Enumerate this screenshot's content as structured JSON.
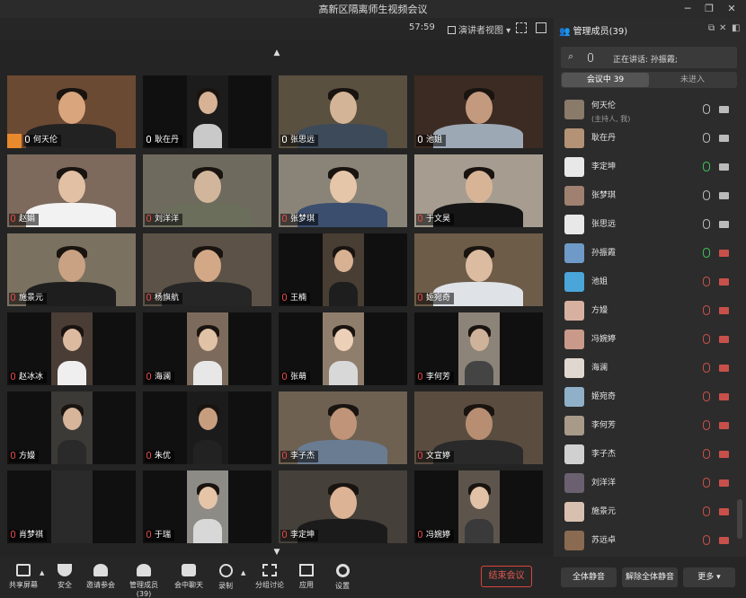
{
  "window": {
    "title": "高新区隔离师生视频会议"
  },
  "subbar": {
    "timer": "57:59",
    "view_mode": "演讲者视图"
  },
  "tiles": [
    {
      "name": "何天伦",
      "host": true,
      "bg": "#6b4a33",
      "fg": "#d9a57c",
      "shirt": "#222"
    },
    {
      "name": "耿在丹",
      "bg": "#1c1c1c",
      "fg": "#d7b295",
      "shirt": "#c9c9c9"
    },
    {
      "name": "张思远",
      "bg": "#5a5040",
      "fg": "#d4b497",
      "shirt": "#3d4a5a"
    },
    {
      "name": "池姐",
      "bg": "#3c2b22",
      "fg": "#c49a7e",
      "shirt": "#9da8b5"
    },
    {
      "name": "赵娟",
      "bg": "#7d6a5c",
      "fg": "#e1c0a4",
      "shirt": "#f2f2f2"
    },
    {
      "name": "刘洋洋",
      "bg": "#6e6a5e",
      "fg": "#d2b69c",
      "shirt": "#6b6e5a"
    },
    {
      "name": "张梦琪",
      "bg": "#8a8478",
      "fg": "#e6c6a8",
      "shirt": "#3b4e6e"
    },
    {
      "name": "于文昊",
      "bg": "#a69d90",
      "fg": "#d8b497",
      "shirt": "#151515"
    },
    {
      "name": "施景元",
      "bg": "#7b7160",
      "fg": "#c9a283",
      "shirt": "#1e1e1e"
    },
    {
      "name": "杨旗航",
      "bg": "#5c5247",
      "fg": "#d3a887",
      "shirt": "#262626"
    },
    {
      "name": "王楠",
      "bg": "#493e33",
      "fg": "#d8b193",
      "shirt": "#1e1e1e"
    },
    {
      "name": "姬宛奇",
      "bg": "#6d5c48",
      "fg": "#dcbca0",
      "shirt": "#dfe3e8"
    },
    {
      "name": "赵冰冰",
      "bg": "#4a3d36",
      "fg": "#dcbaa0",
      "shirt": "#efefef"
    },
    {
      "name": "海澜",
      "bg": "#7c6b5c",
      "fg": "#e0c2a6",
      "shirt": "#e7e7e7"
    },
    {
      "name": "张萌",
      "bg": "#907e6c",
      "fg": "#ecd0b8",
      "shirt": "#d8d8d8"
    },
    {
      "name": "李何芳",
      "bg": "#8c8478",
      "fg": "#cfb29a",
      "shirt": "#444"
    },
    {
      "name": "方嫚",
      "bg": "#3b3a36",
      "fg": "#d6b59a",
      "shirt": "#2a2a2a"
    },
    {
      "name": "朱优",
      "bg": "#1b1b1b",
      "fg": "#c79d80",
      "shirt": "#222"
    },
    {
      "name": "李子杰",
      "bg": "#6e6152",
      "fg": "#bf9478",
      "shirt": "#6a7c92"
    },
    {
      "name": "文宣婷",
      "bg": "#5a4d40",
      "fg": "#b78e72",
      "shirt": "#2a2a2a"
    },
    {
      "name": "肖梦祺",
      "bg": "#2a2a2a",
      "fg": "#2a2a2a",
      "shirt": "#2a2a2a"
    },
    {
      "name": "于瑞",
      "bg": "#8d8b86",
      "fg": "#e5c4a8",
      "shirt": "#d8d8d8"
    },
    {
      "name": "李定坤",
      "bg": "#45403a",
      "fg": "#dcb394",
      "shirt": "#1b1b1b"
    },
    {
      "name": "冯婉婷",
      "bg": "#5d554c",
      "fg": "#e1c2a6",
      "shirt": "#3a3a3a"
    }
  ],
  "panel": {
    "title": "管理成员(39)",
    "speaking": "正在讲话: 孙振霞;",
    "tab_in": "会议中 39",
    "tab_out": "未进入",
    "members": [
      {
        "name": "何天伦",
        "sub": "(主持人, 我)",
        "mic": "normal",
        "cam": "on",
        "av": "#8a7a6a"
      },
      {
        "name": "耿在丹",
        "mic": "normal",
        "cam": "on",
        "av": "#b49276"
      },
      {
        "name": "李定坤",
        "mic": "on",
        "cam": "on",
        "av": "#e8e8e8"
      },
      {
        "name": "张梦琪",
        "mic": "normal",
        "cam": "on",
        "av": "#a08070"
      },
      {
        "name": "张思远",
        "mic": "normal",
        "cam": "on",
        "av": "#e8e8e8"
      },
      {
        "name": "孙振霞",
        "mic": "on",
        "cam": "off",
        "av": "#6f9ac8"
      },
      {
        "name": "池姐",
        "mic": "off",
        "cam": "off",
        "av": "#4aa6d9"
      },
      {
        "name": "方嫚",
        "mic": "off",
        "cam": "off",
        "av": "#d8b0a0"
      },
      {
        "name": "冯婉婷",
        "mic": "off",
        "cam": "off",
        "av": "#c99a8a"
      },
      {
        "name": "海澜",
        "mic": "off",
        "cam": "off",
        "av": "#e0d8d0"
      },
      {
        "name": "姬宛奇",
        "mic": "off",
        "cam": "off",
        "av": "#8fb0c8"
      },
      {
        "name": "李何芳",
        "mic": "off",
        "cam": "off",
        "av": "#a89a88"
      },
      {
        "name": "李子杰",
        "mic": "off",
        "cam": "off",
        "av": "#d0d0d0"
      },
      {
        "name": "刘洋洋",
        "mic": "off",
        "cam": "off",
        "av": "#6a6070"
      },
      {
        "name": "施景元",
        "mic": "off",
        "cam": "off",
        "av": "#d8c0b0"
      },
      {
        "name": "苏远卓",
        "mic": "off",
        "cam": "off",
        "av": "#8a6a50"
      }
    ],
    "btn_mute_all": "全体静音",
    "btn_unmute_all": "解除全体静音",
    "btn_more": "更多"
  },
  "toolbar": {
    "share": "共享屏幕",
    "security": "安全",
    "invite": "邀请参会",
    "members": "管理成员(39)",
    "chat": "会中聊天",
    "record": "录制",
    "breakout": "分组讨论",
    "apps": "应用",
    "settings": "设置",
    "end": "结束会议"
  }
}
